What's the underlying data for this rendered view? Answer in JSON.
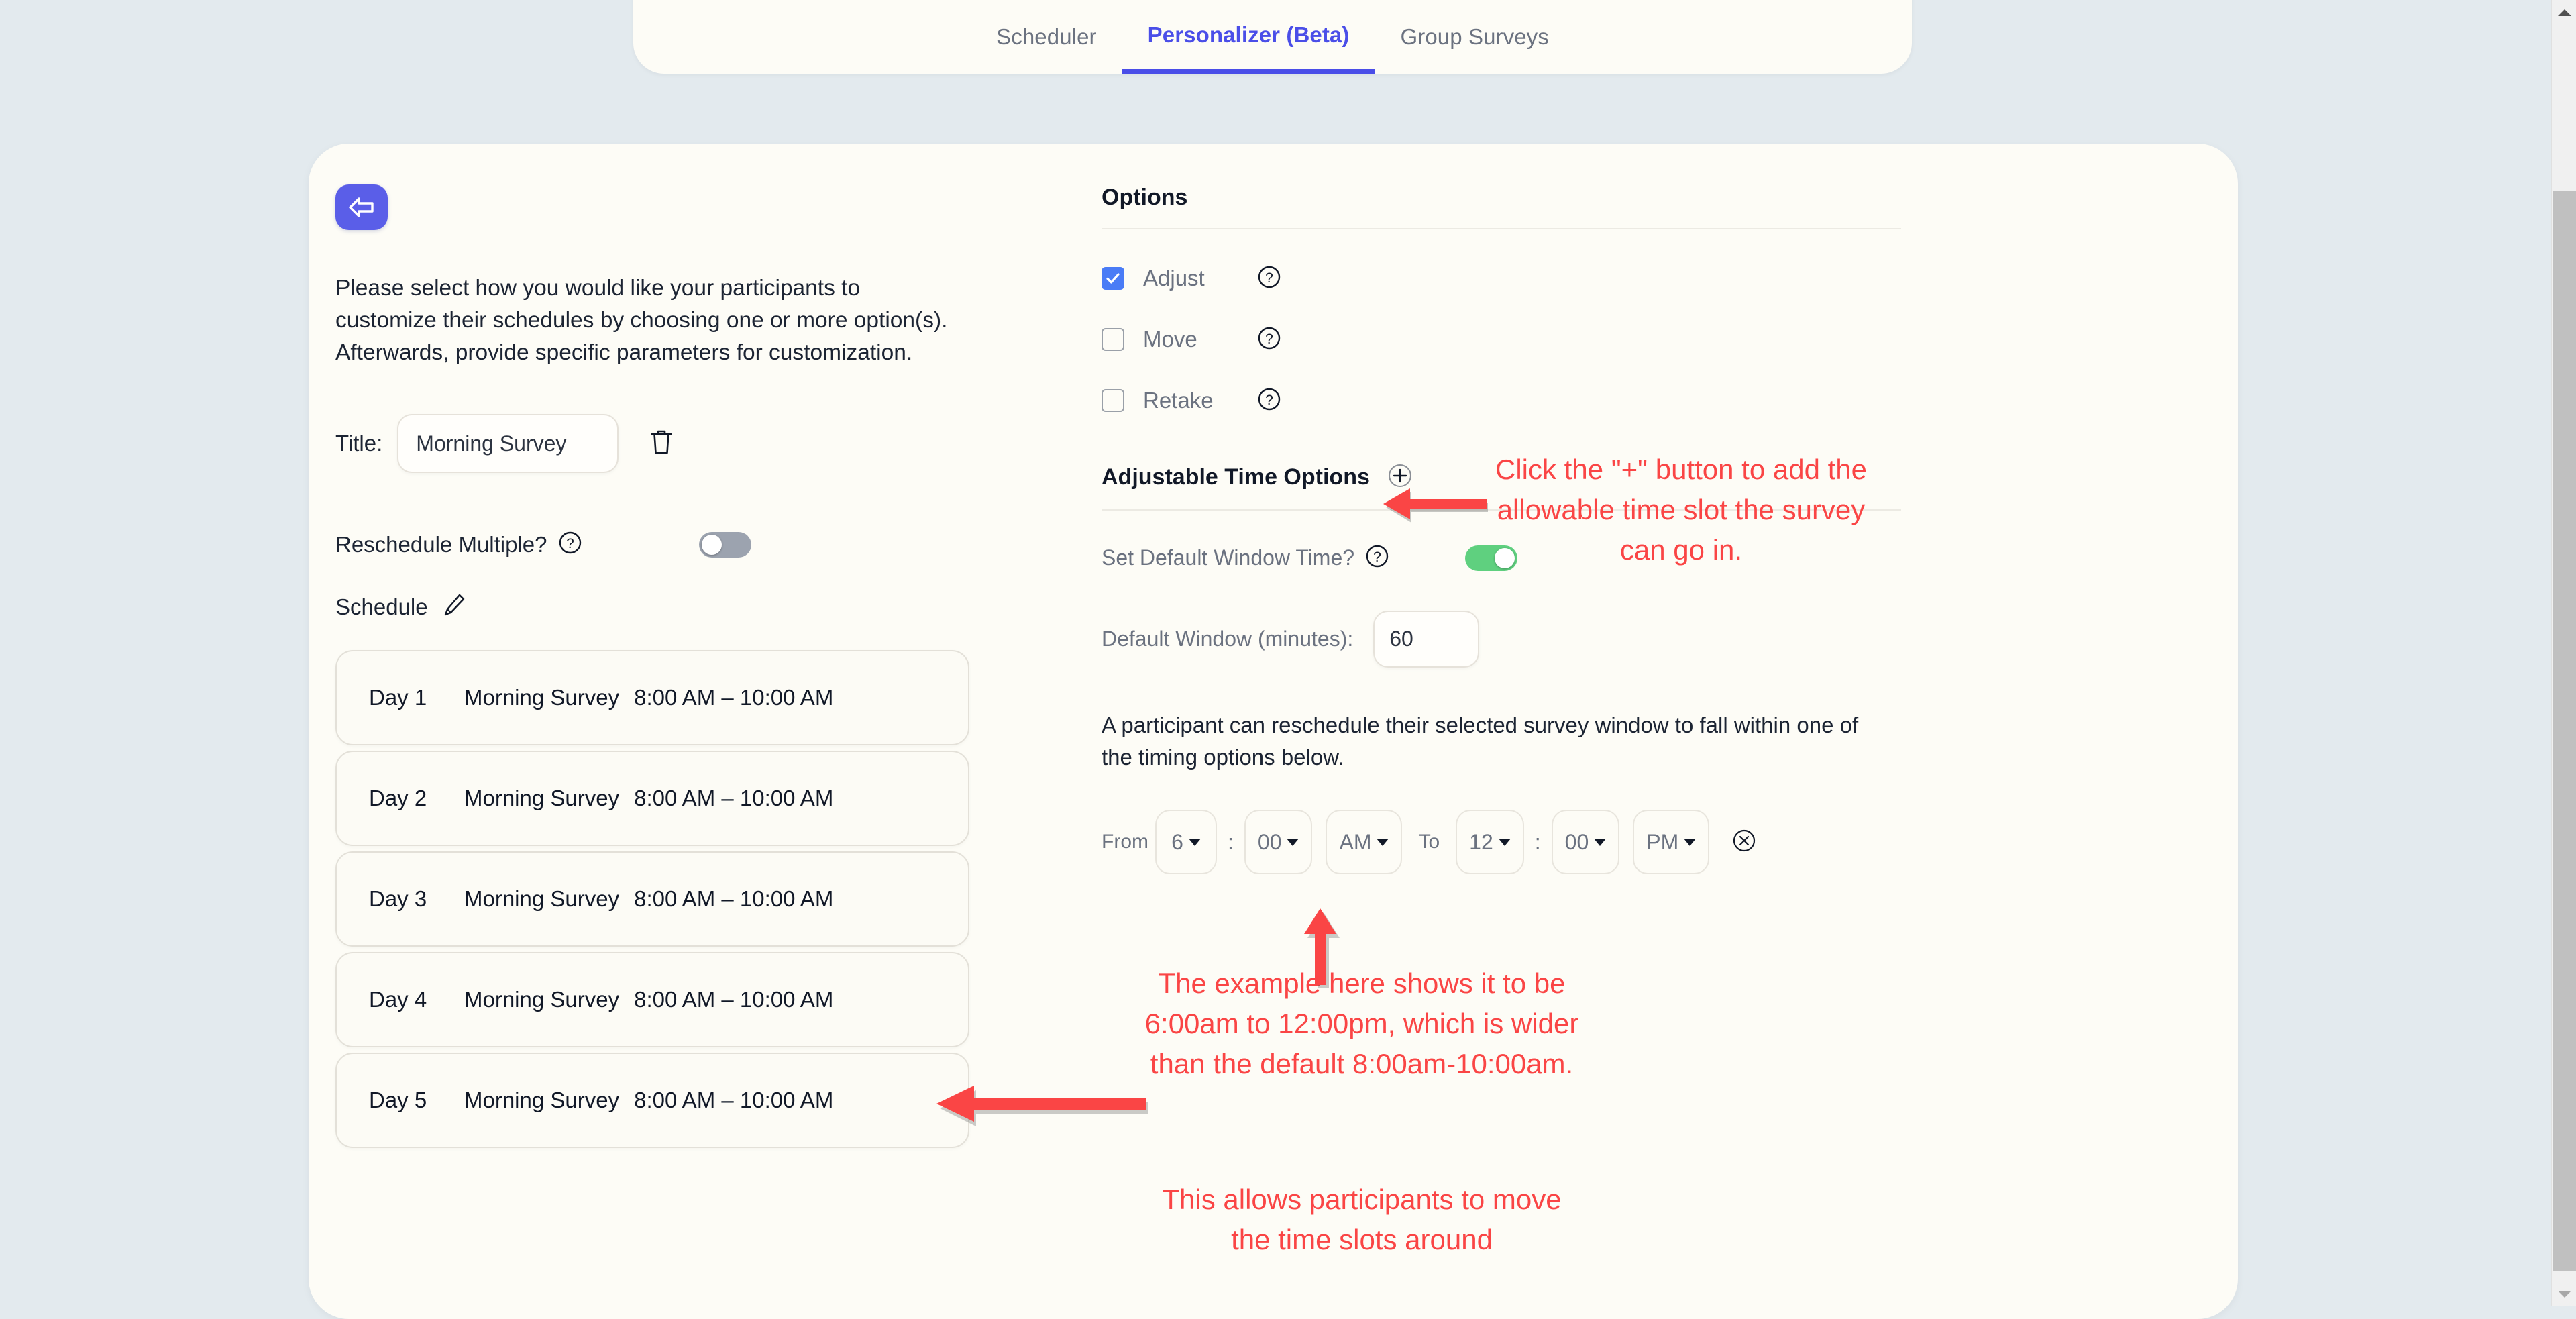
{
  "tabs": [
    {
      "label": "Scheduler",
      "active": false
    },
    {
      "label": "Personalizer (Beta)",
      "active": true
    },
    {
      "label": "Group Surveys",
      "active": false
    }
  ],
  "left_panel": {
    "back_button_icon": "arrow-left-icon",
    "intro_text": "Please select how you would like your participants to customize their schedules by choosing one or more option(s). Afterwards, provide specific parameters for customization.",
    "title_label": "Title:",
    "title_value": "Morning Survey",
    "title_placeholder": "Title",
    "delete_icon": "trash-icon",
    "reschedule_multiple_label": "Reschedule Multiple?",
    "reschedule_multiple_on": false,
    "schedule_label": "Schedule",
    "edit_icon": "pencil-icon",
    "schedule_items": [
      {
        "day": "Day 1",
        "survey": "Morning Survey",
        "time": "8:00 AM – 10:00 AM"
      },
      {
        "day": "Day 2",
        "survey": "Morning Survey",
        "time": "8:00 AM – 10:00 AM"
      },
      {
        "day": "Day 3",
        "survey": "Morning Survey",
        "time": "8:00 AM – 10:00 AM"
      },
      {
        "day": "Day 4",
        "survey": "Morning Survey",
        "time": "8:00 AM – 10:00 AM"
      },
      {
        "day": "Day 5",
        "survey": "Morning Survey",
        "time": "8:00 AM – 10:00 AM"
      }
    ]
  },
  "right_panel": {
    "options_title": "Options",
    "options": [
      {
        "label": "Adjust",
        "checked": true
      },
      {
        "label": "Move",
        "checked": false
      },
      {
        "label": "Retake",
        "checked": false
      }
    ],
    "adjustable_time_options_title": "Adjustable Time Options",
    "add_icon": "plus-circle-icon",
    "set_default_window_label": "Set Default Window Time?",
    "set_default_window_on": true,
    "default_window_label": "Default Window (minutes):",
    "default_window_value": "60",
    "reschedule_description": "A participant can reschedule their selected survey window to fall within one of the timing options below.",
    "time_range": {
      "from_label": "From",
      "to_label": "To",
      "colon": ":",
      "from_hour": "6",
      "from_minute": "00",
      "from_meridiem": "AM",
      "to_hour": "12",
      "to_minute": "00",
      "to_meridiem": "PM",
      "remove_icon": "close-circle-icon"
    }
  },
  "annotations": {
    "plus_note": "Click the \"+\" button to add the allowable time slot the survey can go in.",
    "example_note": "The example here shows it to be 6:00am to 12:00pm, which is wider than the default 8:00am-10:00am.",
    "move_note": "This allows participants to move the time slots around",
    "color": "#fa4545"
  },
  "scrollbar": {
    "up_icon": "caret-up-icon",
    "down_icon": "caret-down-icon"
  }
}
